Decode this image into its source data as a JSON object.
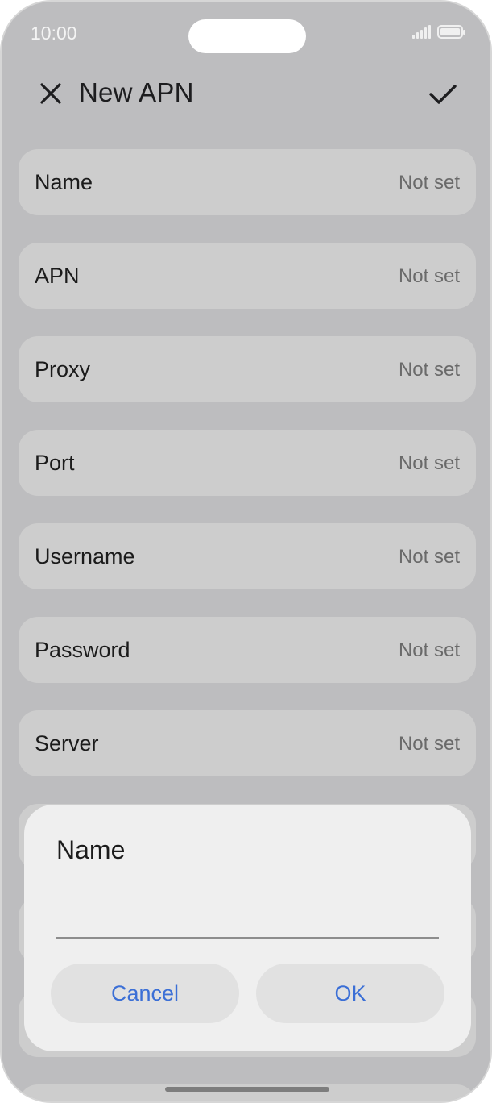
{
  "status_bar": {
    "time": "10:00",
    "signal_icon": "signal-icon",
    "battery_icon": "battery-icon"
  },
  "header": {
    "title": "New APN",
    "close_icon": "close-icon",
    "confirm_icon": "check-icon"
  },
  "fields": [
    {
      "label": "Name",
      "value": "Not set"
    },
    {
      "label": "APN",
      "value": "Not set"
    },
    {
      "label": "Proxy",
      "value": "Not set"
    },
    {
      "label": "Port",
      "value": "Not set"
    },
    {
      "label": "Username",
      "value": "Not set"
    },
    {
      "label": "Password",
      "value": "Not set"
    },
    {
      "label": "Server",
      "value": "Not set"
    }
  ],
  "dialog": {
    "title": "Name",
    "input_value": "",
    "cancel_label": "Cancel",
    "ok_label": "OK"
  },
  "colors": {
    "accent": "#3b6fd6",
    "scrim_background": "#bdbdbf",
    "dialog_background": "#efefef"
  }
}
